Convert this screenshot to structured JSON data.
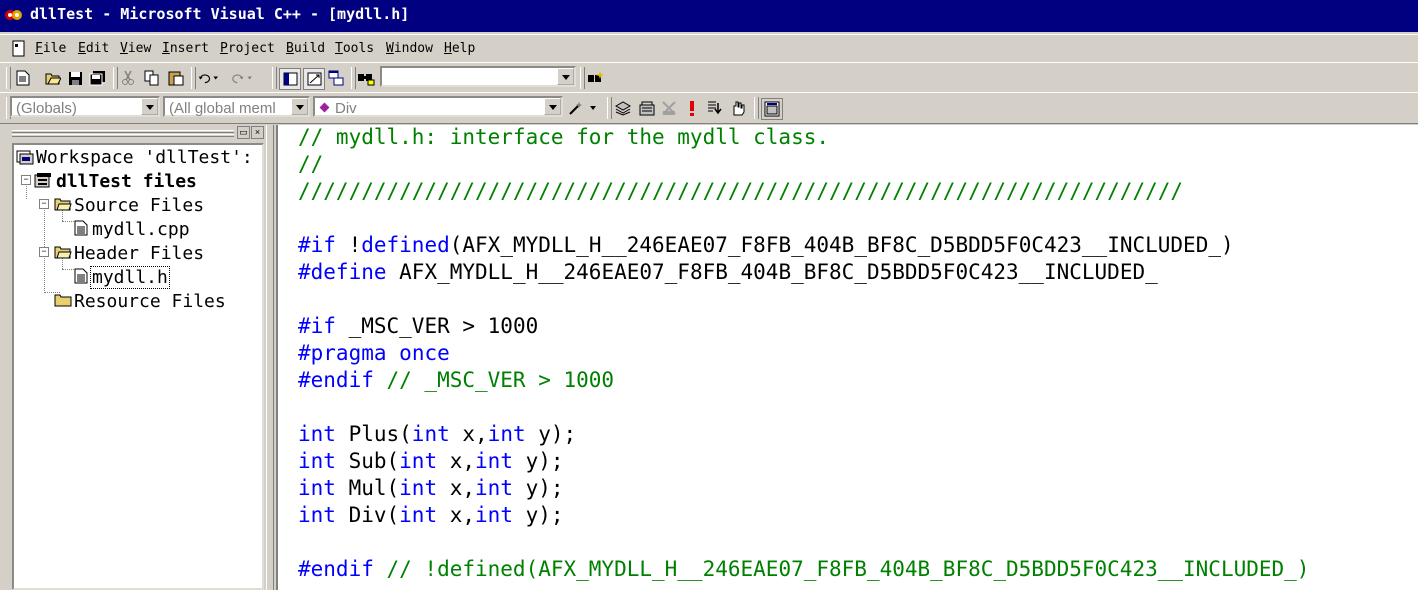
{
  "window": {
    "title": "dllTest - Microsoft Visual C++ - [mydll.h]"
  },
  "menu": {
    "items": [
      {
        "hotkey": "F",
        "rest": "ile"
      },
      {
        "hotkey": "E",
        "rest": "dit"
      },
      {
        "hotkey": "V",
        "rest": "iew"
      },
      {
        "hotkey": "I",
        "rest": "nsert"
      },
      {
        "hotkey": "P",
        "rest": "roject"
      },
      {
        "hotkey": "B",
        "rest": "uild"
      },
      {
        "hotkey": "T",
        "rest": "ools"
      },
      {
        "hotkey": "W",
        "rest": "indow"
      },
      {
        "hotkey": "H",
        "rest": "elp"
      }
    ]
  },
  "toolbar": {
    "find_combo_value": ""
  },
  "wizardbar": {
    "class_combo": "(Globals)",
    "filter_combo": "(All global meml",
    "member_combo": "Div"
  },
  "workspace": {
    "root": "Workspace 'dllTest':",
    "project": "dllTest files",
    "source_folder": "Source Files",
    "source_file": "mydll.cpp",
    "header_folder": "Header Files",
    "header_file": "mydll.h",
    "resource_folder": "Resource Files"
  },
  "editor": {
    "lines": [
      {
        "parts": [
          {
            "t": "// mydll.h: interface for the mydll class.",
            "c": "cm"
          }
        ]
      },
      {
        "parts": [
          {
            "t": "//",
            "c": "cm"
          }
        ]
      },
      {
        "parts": [
          {
            "t": "//////////////////////////////////////////////////////////////////////",
            "c": "cm"
          }
        ]
      },
      {
        "parts": []
      },
      {
        "parts": [
          {
            "t": "#if",
            "c": "kw"
          },
          {
            "t": " !"
          },
          {
            "t": "defined",
            "c": "kw"
          },
          {
            "t": "(AFX_MYDLL_H__246EAE07_F8FB_404B_BF8C_D5BDD5F0C423__INCLUDED_)"
          }
        ]
      },
      {
        "parts": [
          {
            "t": "#define",
            "c": "kw"
          },
          {
            "t": " AFX_MYDLL_H__246EAE07_F8FB_404B_BF8C_D5BDD5F0C423__INCLUDED_"
          }
        ]
      },
      {
        "parts": []
      },
      {
        "parts": [
          {
            "t": "#if",
            "c": "kw"
          },
          {
            "t": " _MSC_VER > 1000"
          }
        ]
      },
      {
        "parts": [
          {
            "t": "#pragma",
            "c": "kw"
          },
          {
            "t": " "
          },
          {
            "t": "once",
            "c": "kw"
          }
        ]
      },
      {
        "parts": [
          {
            "t": "#endif",
            "c": "kw"
          },
          {
            "t": " // _MSC_VER > 1000",
            "c": "cm"
          }
        ]
      },
      {
        "parts": []
      },
      {
        "parts": [
          {
            "t": "int",
            "c": "kw"
          },
          {
            "t": " Plus("
          },
          {
            "t": "int",
            "c": "kw"
          },
          {
            "t": " x,"
          },
          {
            "t": "int",
            "c": "kw"
          },
          {
            "t": " y);"
          }
        ]
      },
      {
        "parts": [
          {
            "t": "int",
            "c": "kw"
          },
          {
            "t": " Sub("
          },
          {
            "t": "int",
            "c": "kw"
          },
          {
            "t": " x,"
          },
          {
            "t": "int",
            "c": "kw"
          },
          {
            "t": " y);"
          }
        ]
      },
      {
        "parts": [
          {
            "t": "int",
            "c": "kw"
          },
          {
            "t": " Mul("
          },
          {
            "t": "int",
            "c": "kw"
          },
          {
            "t": " x,"
          },
          {
            "t": "int",
            "c": "kw"
          },
          {
            "t": " y);"
          }
        ]
      },
      {
        "parts": [
          {
            "t": "int",
            "c": "kw"
          },
          {
            "t": " Div("
          },
          {
            "t": "int",
            "c": "kw"
          },
          {
            "t": " x,"
          },
          {
            "t": "int",
            "c": "kw"
          },
          {
            "t": " y);"
          }
        ]
      },
      {
        "parts": []
      },
      {
        "parts": [
          {
            "t": "#endif",
            "c": "kw"
          },
          {
            "t": " // !defined(AFX_MYDLL_H__246EAE07_F8FB_404B_BF8C_D5BDD5F0C423__INCLUDED_)",
            "c": "cm"
          }
        ]
      }
    ]
  },
  "colors": {
    "keyword": "#0000ff",
    "comment": "#008000",
    "titlebar": "#000080"
  },
  "icons": [
    "app-icon",
    "new-text-file-icon",
    "open-icon",
    "save-icon",
    "save-all-icon",
    "cut-icon",
    "copy-icon",
    "paste-icon",
    "undo-icon",
    "redo-icon",
    "workspace-toggle-icon",
    "output-toggle-icon",
    "window-list-icon",
    "find-in-files-icon",
    "find-icon",
    "class-wizard-icon",
    "compile-icon",
    "build-icon",
    "stop-build-icon",
    "execute-icon",
    "go-icon",
    "breakpoint-icon"
  ]
}
